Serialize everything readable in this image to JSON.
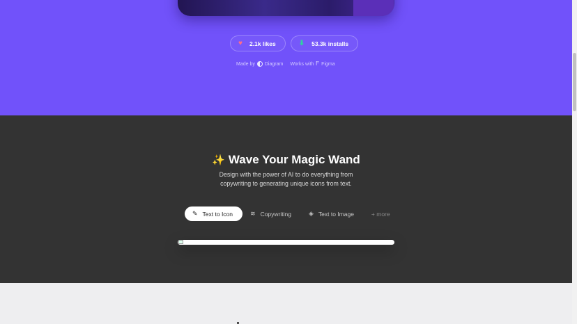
{
  "stats": {
    "likes": "2.1k likes",
    "installs": "53.3k installs",
    "likes_icon": "heart-icon",
    "installs_icon": "download-icon"
  },
  "credits": {
    "made_by_label": "Made by",
    "made_by_name": "Diagram",
    "works_with_label": "Works with",
    "works_with_name": "Figma"
  },
  "feature": {
    "title": "Wave Your Magic Wand",
    "description": "Design with the power of AI to do everything from copywriting to generating unique icons from text.",
    "tabs": [
      {
        "label": "Text to Icon",
        "icon": "pen-tool-icon",
        "active": true
      },
      {
        "label": "Copywriting",
        "icon": "lines-icon",
        "active": false
      },
      {
        "label": "Text to Image",
        "icon": "layers-icon",
        "active": false
      },
      {
        "label": "+ more",
        "active": false
      }
    ]
  },
  "colors": {
    "hero_bg": "#7152fa",
    "dark_bg": "#333333",
    "light_bg": "#eeeef0",
    "heart": "#ff6b8a",
    "download": "#2fd3a0"
  }
}
